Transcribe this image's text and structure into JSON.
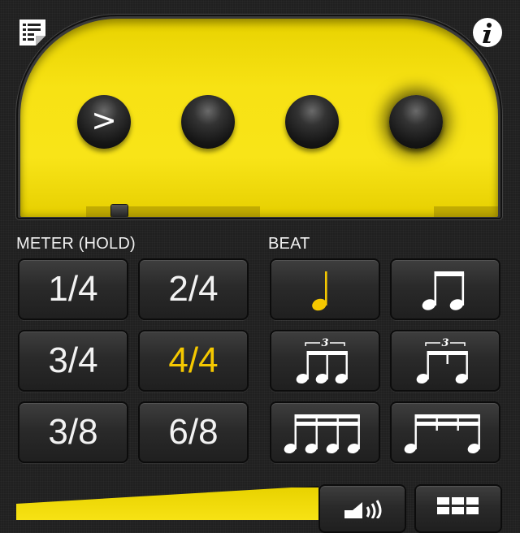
{
  "colors": {
    "accent": "#f5c800",
    "panel_yellow": "#f7e214",
    "background": "#202020"
  },
  "top_icons": {
    "left": "list-icon",
    "right": "info-icon"
  },
  "beat_indicator": {
    "accent_symbol": ">",
    "dots": 4,
    "active_dot": 4
  },
  "meter": {
    "label": "METER (HOLD)",
    "options": [
      "1/4",
      "2/4",
      "3/4",
      "4/4",
      "3/8",
      "6/8"
    ],
    "selected": "4/4"
  },
  "beat": {
    "label": "BEAT",
    "options": [
      {
        "icon": "quarter-note-icon",
        "selected": true
      },
      {
        "icon": "eighth-notes-icon",
        "selected": false
      },
      {
        "icon": "triplet-eighths-icon",
        "selected": false
      },
      {
        "icon": "triplet-shuffle-icon",
        "selected": false
      },
      {
        "icon": "sixteenth-notes-icon",
        "selected": false
      },
      {
        "icon": "eighth-two-sixteenths-icon",
        "selected": false
      }
    ],
    "triplet_mark": "3"
  },
  "bottom_bar": {
    "left_button_icon": "speaker-icon",
    "right_button_icon": "grid-icon"
  }
}
